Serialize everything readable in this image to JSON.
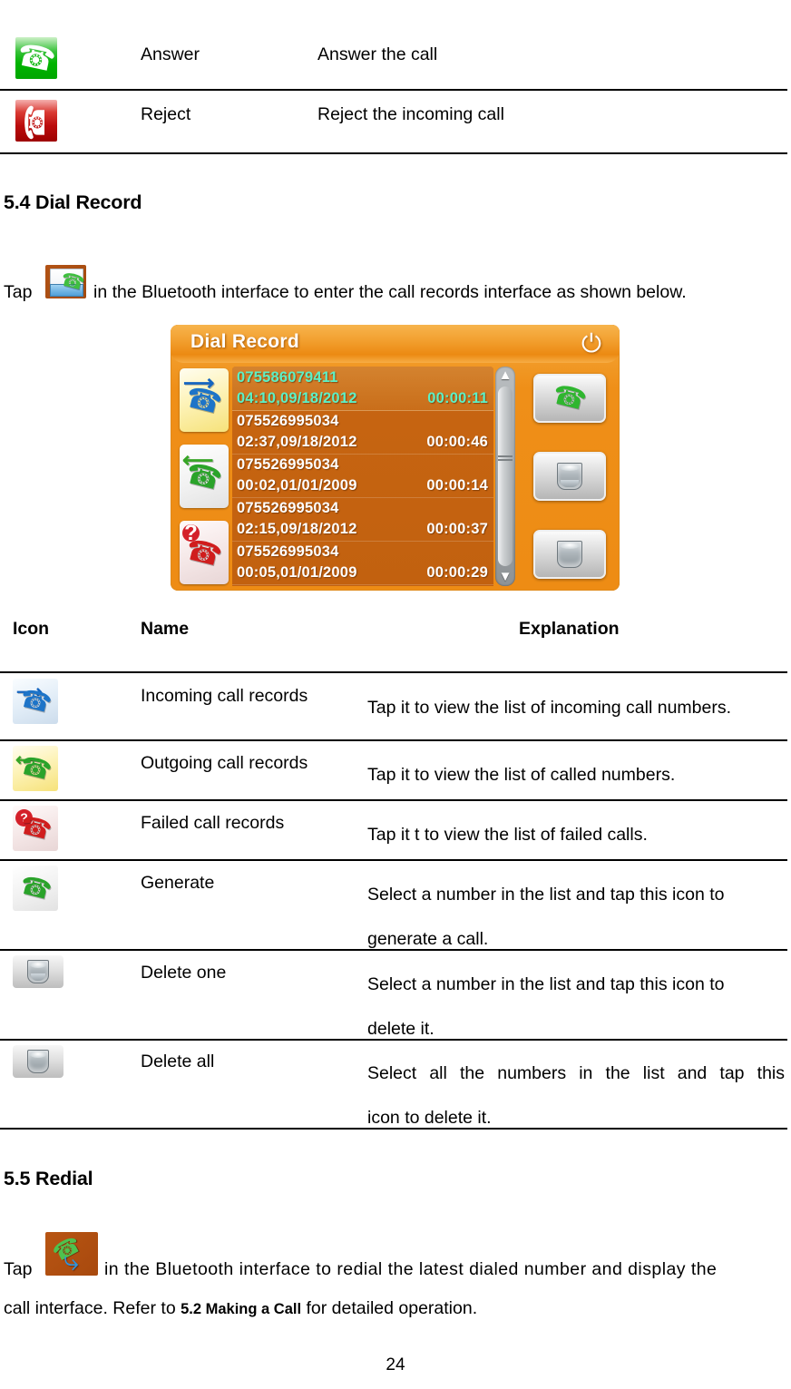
{
  "document": {
    "page_number": "24"
  },
  "call_actions_table": {
    "rows": [
      {
        "icon": "answer-call-icon",
        "name": "Answer",
        "description": "Answer the call"
      },
      {
        "icon": "reject-call-icon",
        "name": "Reject",
        "description": "Reject the incoming call"
      }
    ]
  },
  "section_dial_record": {
    "heading": "5.4 Dial Record",
    "intro_prefix": "Tap",
    "intro_icon": "dial-record-icon",
    "intro_suffix": "in the Bluetooth interface to enter the call records interface as shown below."
  },
  "dial_record_screen": {
    "title": "Dial Record",
    "power_icon": "power-icon",
    "filters": [
      {
        "icon": "incoming-call-filter-icon",
        "state": "selected"
      },
      {
        "icon": "outgoing-call-filter-icon",
        "state": "normal"
      },
      {
        "icon": "failed-call-filter-icon",
        "state": "normal"
      }
    ],
    "records": [
      {
        "number": "075586079411",
        "timestamp": "04:10,09/18/2012",
        "duration": "00:00:11",
        "selected": true
      },
      {
        "number": "075526995034",
        "timestamp": "02:37,09/18/2012",
        "duration": "00:00:46",
        "selected": false
      },
      {
        "number": "075526995034",
        "timestamp": "00:02,01/01/2009",
        "duration": "00:00:14",
        "selected": false
      },
      {
        "number": "075526995034",
        "timestamp": "02:15,09/18/2012",
        "duration": "00:00:37",
        "selected": false
      },
      {
        "number": "075526995034",
        "timestamp": "00:05,01/01/2009",
        "duration": "00:00:29",
        "selected": false
      }
    ],
    "scrollbar": {
      "up_arrow": "▲",
      "down_arrow": "▼"
    },
    "action_buttons": [
      {
        "icon": "generate-call-icon"
      },
      {
        "icon": "delete-one-icon"
      },
      {
        "icon": "delete-all-icon"
      }
    ]
  },
  "legend_table": {
    "headers": {
      "icon": "Icon",
      "name": "Name",
      "explanation": "Explanation"
    },
    "rows": [
      {
        "icon": "incoming-call-records-icon",
        "name": "Incoming call records",
        "explanation": "Tap it to view the list of incoming call numbers."
      },
      {
        "icon": "outgoing-call-records-icon",
        "name": "Outgoing call records",
        "explanation": "Tap it to view the list of called numbers."
      },
      {
        "icon": "failed-call-records-icon",
        "name": "Failed call records",
        "explanation": "Tap it t to view the list of failed calls."
      },
      {
        "icon": "generate-call-icon",
        "name": "Generate",
        "explanation_line1": "Select a number in the list and tap this icon to",
        "explanation_line2": "generate a call."
      },
      {
        "icon": "delete-one-icon",
        "name": "Delete one",
        "explanation_line1": "Select a number in the list and tap this icon to",
        "explanation_line2": "delete it."
      },
      {
        "icon": "delete-all-icon",
        "name": "Delete all",
        "explanation_line1": "Select all the numbers in the list and tap this",
        "explanation_line2": "icon to delete it."
      }
    ]
  },
  "section_redial": {
    "heading": "5.5 Redial",
    "intro_prefix": "Tap",
    "intro_icon": "redial-icon",
    "line1_suffix": "in the Bluetooth interface to redial the latest dialed number and display the",
    "line2_part1": "call interface. Refer to",
    "line2_ref": "5.2 Making a Call",
    "line2_part2": "for detailed operation."
  },
  "colors": {
    "device_orange": "#ee8c14",
    "list_brown": "#c46412",
    "selected_text": "#5cf0c6"
  }
}
